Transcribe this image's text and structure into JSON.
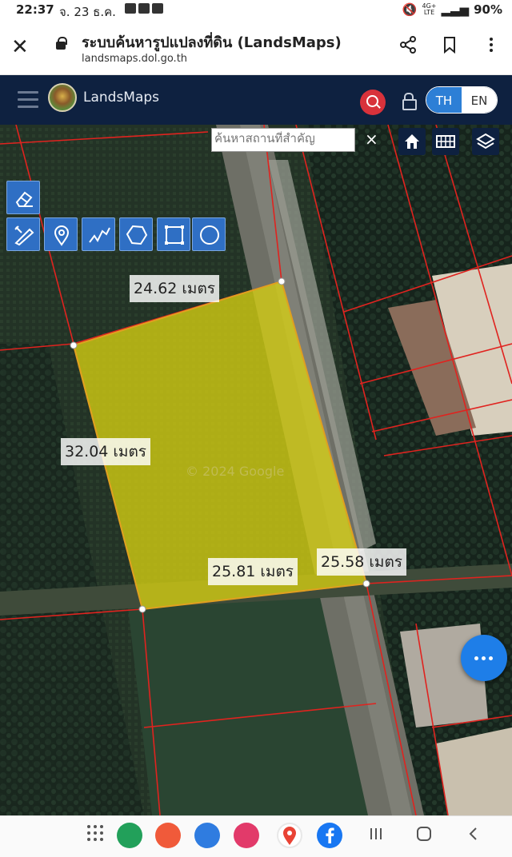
{
  "status_bar": {
    "time": "22:37",
    "date": "จ. 23 ธ.ค.",
    "network": "4G+",
    "network_sub": "LTE",
    "battery": "90%"
  },
  "browser": {
    "title": "ระบบค้นหารูปแปลงที่ดิน (LandsMaps)",
    "url": "landsmaps.dol.go.th"
  },
  "app_header": {
    "brand": "LandsMaps",
    "lang_th": "TH",
    "lang_en": "EN"
  },
  "map": {
    "search": {
      "placeholder": "ค้นหาสถานที่สำคัญ",
      "value": ""
    },
    "clear_label": "×",
    "measurements": {
      "top": "24.62 เมตร",
      "left": "32.04 เมตร",
      "bottom": "25.81 เมตร",
      "right": "25.58 เมตร"
    },
    "watermark": "© 2024 Google",
    "parcel_fill_color": "#d6cf12",
    "boundary_color": "#e0231f"
  },
  "colors": {
    "header_bg": "#0e2140",
    "accent_blue": "#2d7fd6",
    "search_red": "#d8323b",
    "fab_blue": "#1e7ee8"
  }
}
